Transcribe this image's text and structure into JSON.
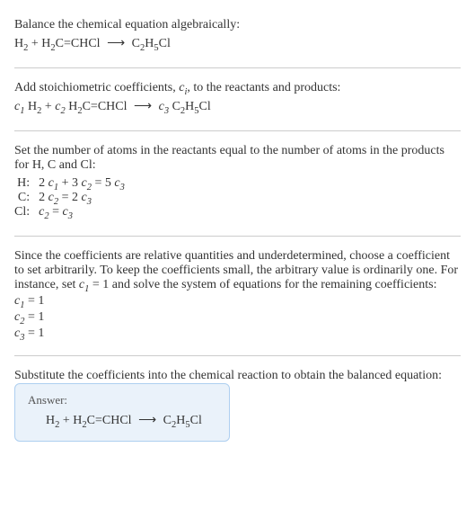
{
  "intro_text": "Balance the chemical equation algebraically:",
  "eq1": {
    "lhs1": "H",
    "lhs1_sub": "2",
    "plus1": " + ",
    "lhs2a": "H",
    "lhs2a_sub": "2",
    "lhs2b": "C=CHCl",
    "arrow": "⟶",
    "rhs1": "C",
    "rhs1_sub": "2",
    "rhs2": "H",
    "rhs2_sub": "5",
    "rhs3": "Cl"
  },
  "step2_text_a": "Add stoichiometric coefficients, ",
  "step2_ci": "c",
  "step2_ci_sub": "i",
  "step2_text_b": ", to the reactants and products:",
  "eq2": {
    "c1": "c",
    "c1_sub": "1",
    "sp1": " ",
    "lhs1": "H",
    "lhs1_sub": "2",
    "plus1": " + ",
    "c2": "c",
    "c2_sub": "2",
    "sp2": " ",
    "lhs2a": "H",
    "lhs2a_sub": "2",
    "lhs2b": "C=CHCl",
    "arrow": "⟶",
    "c3": "c",
    "c3_sub": "3",
    "sp3": " ",
    "rhs1": "C",
    "rhs1_sub": "2",
    "rhs2": "H",
    "rhs2_sub": "5",
    "rhs3": "Cl"
  },
  "step3_text": "Set the number of atoms in the reactants equal to the number of atoms in the products for H, C and Cl:",
  "atom_eqs": [
    {
      "label": "H:",
      "pre1": "2 ",
      "c1": "c",
      "c1s": "1",
      "mid": " + 3 ",
      "c2": "c",
      "c2s": "2",
      "eq": " = 5 ",
      "c3": "c",
      "c3s": "3"
    },
    {
      "label": "C:",
      "pre1": "2 ",
      "c1": "c",
      "c1s": "2",
      "mid": "",
      "c2": "",
      "c2s": "",
      "eq": " = 2 ",
      "c3": "c",
      "c3s": "3"
    },
    {
      "label": "Cl:",
      "pre1": "",
      "c1": "c",
      "c1s": "2",
      "mid": "",
      "c2": "",
      "c2s": "",
      "eq": " = ",
      "c3": "c",
      "c3s": "3"
    }
  ],
  "step4_text_a": "Since the coefficients are relative quantities and underdetermined, choose a coefficient to set arbitrarily. To keep the coefficients small, the arbitrary value is ordinarily one. For instance, set ",
  "step4_c1": "c",
  "step4_c1_sub": "1",
  "step4_text_b": " = 1 and solve the system of equations for the remaining coefficients:",
  "solved": [
    {
      "c": "c",
      "cs": "1",
      "rhs": " = 1"
    },
    {
      "c": "c",
      "cs": "2",
      "rhs": " = 1"
    },
    {
      "c": "c",
      "cs": "3",
      "rhs": " = 1"
    }
  ],
  "step5_text": "Substitute the coefficients into the chemical reaction to obtain the balanced equation:",
  "answer_label": "Answer:",
  "eq_final": {
    "lhs1": "H",
    "lhs1_sub": "2",
    "plus1": " + ",
    "lhs2a": "H",
    "lhs2a_sub": "2",
    "lhs2b": "C=CHCl",
    "arrow": "⟶",
    "rhs1": "C",
    "rhs1_sub": "2",
    "rhs2": "H",
    "rhs2_sub": "5",
    "rhs3": "Cl"
  }
}
